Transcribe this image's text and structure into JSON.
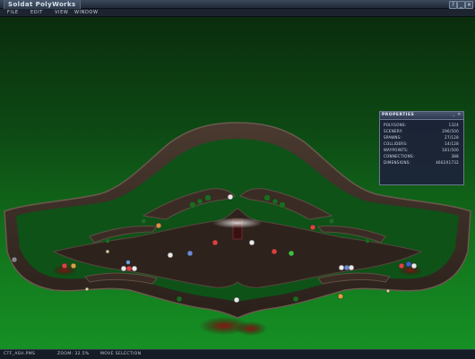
{
  "app": {
    "title": "Soldat PolyWorks"
  },
  "window_controls": {
    "help": "?",
    "minimize": "_",
    "restore": "⤢",
    "close": "✕"
  },
  "menu": [
    "File",
    "Edit",
    "View",
    "Window"
  ],
  "properties": {
    "title": "Properties",
    "controls": [
      "_",
      "✕"
    ],
    "rows": [
      {
        "label": "Polygons:",
        "value": "1324"
      },
      {
        "label": "Scenery:",
        "value": "296/500"
      },
      {
        "label": "Spawns:",
        "value": "27/128"
      },
      {
        "label": "Colliders:",
        "value": "14/128"
      },
      {
        "label": "Waypoints:",
        "value": "181/500"
      },
      {
        "label": "Connections:",
        "value": "388"
      },
      {
        "label": "Dimensions:",
        "value": "4602x1732"
      }
    ]
  },
  "status": {
    "file": "ctf_Ash.PMS",
    "zoom": "Zoom: 32.5%",
    "tool": "Move Selection"
  },
  "colors": {
    "rock": "#3a2c24",
    "rock_edge": "#5f4e43",
    "rock_dark": "#1e1814",
    "lava": "#6b1010",
    "sky_top": "#0a2d0d",
    "sky_bottom": "#169025"
  },
  "icons": [
    "spawn-marker-icon",
    "flag-marker-icon",
    "collider-marker-icon",
    "help-icon",
    "minimize-icon",
    "restore-icon",
    "close-icon"
  ]
}
